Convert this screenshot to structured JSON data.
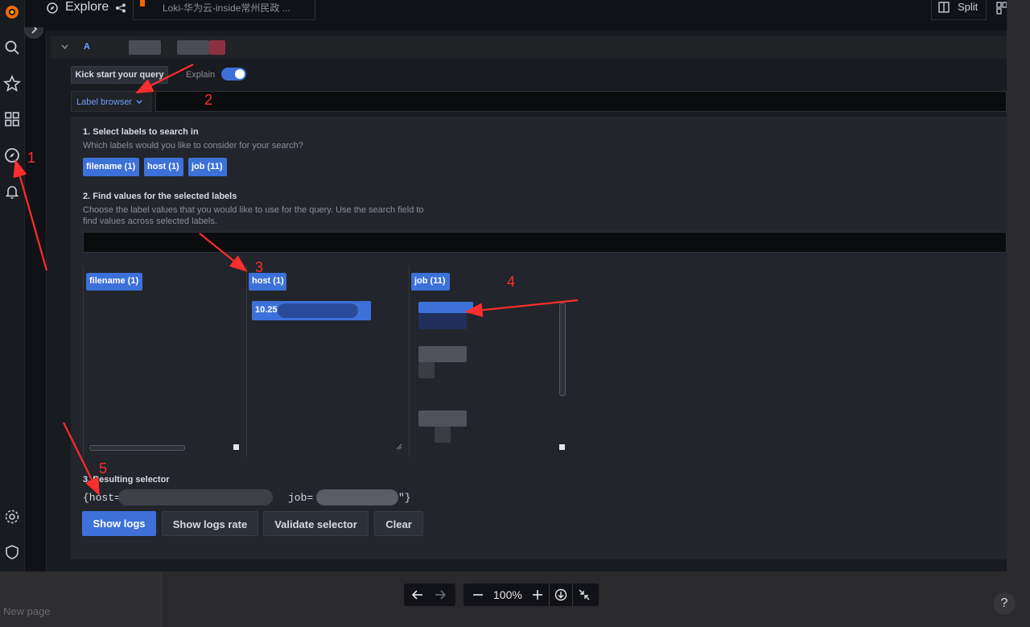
{
  "header": {
    "title": "Explore",
    "datasource": "Loki-华为云-inside常州民政 ...",
    "split_label": "Split"
  },
  "query": {
    "row_letter": "A",
    "kick_start_label": "Kick start your query",
    "explain_label": "Explain",
    "label_browser_label": "Label browser"
  },
  "browser": {
    "step1_title": "1. Select labels to search in",
    "step1_desc": "Which labels would you like to consider for your search?",
    "labels": [
      "filename (1)",
      "host (1)",
      "job (11)"
    ],
    "step2_title": "2. Find values for the selected labels",
    "step2_desc_line1": "Choose the label values that you would like to use for the query. Use the search field to",
    "step2_desc_line2": "find values across selected labels.",
    "host_value": "10.25",
    "step3_title": "3. Resulting selector",
    "selector_start": "{host=",
    "selector_job": "job=",
    "selector_end": "\"}"
  },
  "buttons": {
    "show_logs": "Show logs",
    "show_logs_rate": "Show logs rate",
    "validate_selector": "Validate selector",
    "clear": "Clear"
  },
  "toolbar": {
    "zoom": "100%"
  },
  "footer": {
    "new_page": "New page",
    "help": "?"
  },
  "annotations": [
    "1",
    "2",
    "3",
    "4",
    "5"
  ],
  "colors": {
    "primary": "#3d71d9",
    "annotation": "#ff2d2d",
    "background": "#111217"
  }
}
